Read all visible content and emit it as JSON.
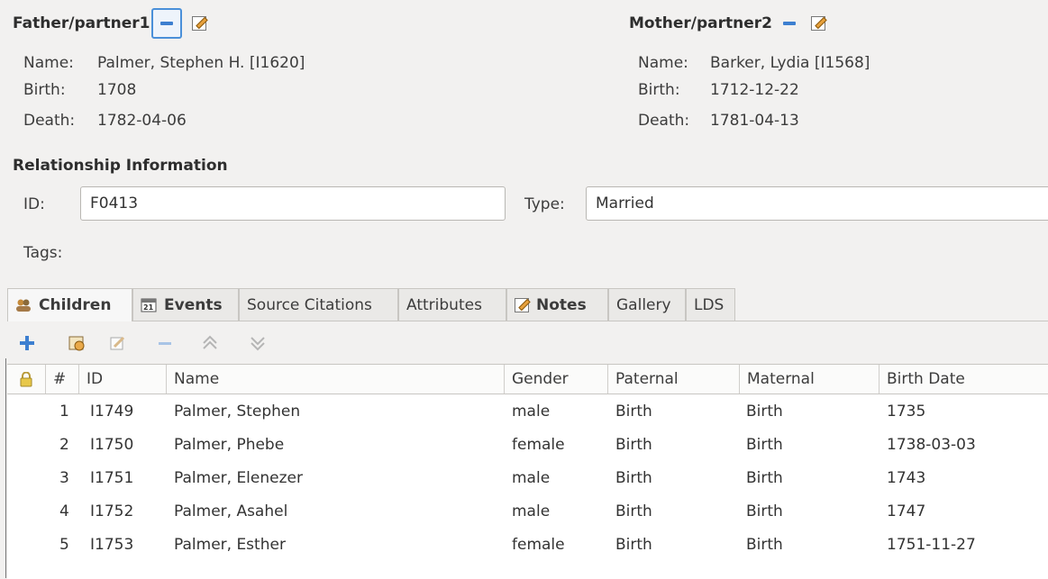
{
  "father": {
    "heading": "Father/partner1",
    "name_label": "Name:",
    "name": "Palmer, Stephen H. [I1620]",
    "birth_label": "Birth:",
    "birth": "1708",
    "death_label": "Death:",
    "death": "1782-04-06"
  },
  "mother": {
    "heading": "Mother/partner2",
    "name_label": "Name:",
    "name": "Barker, Lydia [I1568]",
    "birth_label": "Birth:",
    "birth": "1712-12-22",
    "death_label": "Death:",
    "death": "1781-04-13"
  },
  "relationship": {
    "heading": "Relationship Information",
    "id_label": "ID:",
    "id_value": "F0413",
    "type_label": "Type:",
    "type_value": "Married",
    "tags_label": "Tags:"
  },
  "tabs": [
    {
      "label": "Children",
      "icon": "children-icon",
      "active": true
    },
    {
      "label": "Events",
      "icon": "calendar-icon",
      "active": false
    },
    {
      "label": "Source Citations",
      "active": false
    },
    {
      "label": "Attributes",
      "active": false
    },
    {
      "label": "Notes",
      "icon": "note-icon",
      "active": false
    },
    {
      "label": "Gallery",
      "active": false
    },
    {
      "label": "LDS",
      "active": false
    }
  ],
  "toolbar": [
    "add-icon",
    "share-icon",
    "edit-icon",
    "remove-icon",
    "move-up-icon",
    "move-down-icon"
  ],
  "table": {
    "columns": [
      "#",
      "ID",
      "Name",
      "Gender",
      "Paternal",
      "Maternal",
      "Birth Date"
    ],
    "rows": [
      [
        "1",
        "I1749",
        "Palmer, Stephen",
        "male",
        "Birth",
        "Birth",
        "1735"
      ],
      [
        "2",
        "I1750",
        "Palmer, Phebe",
        "female",
        "Birth",
        "Birth",
        "1738-03-03"
      ],
      [
        "3",
        "I1751",
        "Palmer, Elenezer",
        "male",
        "Birth",
        "Birth",
        "1743"
      ],
      [
        "4",
        "I1752",
        "Palmer, Asahel",
        "male",
        "Birth",
        "Birth",
        "1747"
      ],
      [
        "5",
        "I1753",
        "Palmer, Esther",
        "female",
        "Birth",
        "Birth",
        "1751-11-27"
      ]
    ]
  },
  "colors": {
    "accent": "#3d7fd0",
    "background": "#f2f1f0"
  }
}
